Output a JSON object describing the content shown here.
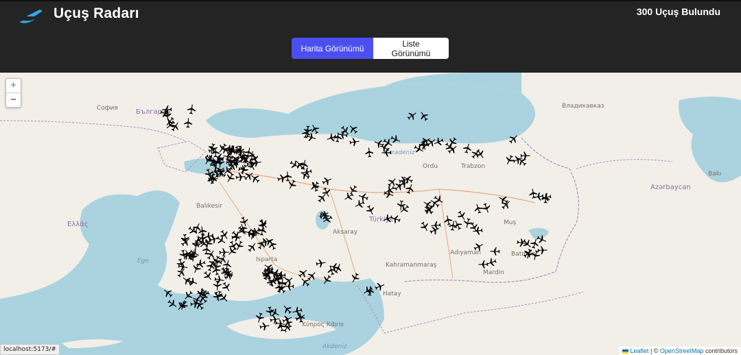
{
  "header": {
    "title": "Uçuş Radarı",
    "flight_count_text": "300 Uçuş Bulundu",
    "logo_icon": "plane-swoosh-icon"
  },
  "view_toggle": {
    "map_label": "Harita Görünümü",
    "list_label": "Liste Görünümü",
    "active": "map",
    "active_color": "#4b4ff0"
  },
  "map": {
    "zoom_in": "+",
    "zoom_out": "−",
    "plane_icon": "airplane-icon",
    "plane_color": "#000000",
    "sea_color": "#aad3df",
    "land_color": "#f2efe9",
    "labels": {
      "turkiye": "Türkiye",
      "karadeniz": "Karadeniz",
      "akdeniz": "Akdeniz",
      "ege": "Ege",
      "kibris": "Κύπρος Kıbrıs",
      "azerbaycan": "Azərbaycan",
      "ellada": "Ελλάς",
      "bulgaria": "България",
      "sofia": "София",
      "vladikavkaz": "Владикавказ",
      "baku": "Bakı",
      "balikesir": "Balıkesir",
      "isparta": "Isparta",
      "aksaray": "Aksaray",
      "adiyaman": "Adıyaman",
      "batman": "Batman",
      "mus": "Muş",
      "ordu": "Ordu",
      "trabzon": "Trabzon",
      "kahramanmaras": "Kahramanmaraş",
      "hatay": "Hatay",
      "mardin": "Mardin"
    },
    "attribution": {
      "leaflet": "Leaflet",
      "separator": " | © ",
      "osm": "OpenStreetMap",
      "suffix": " contributors"
    }
  },
  "status_bar": {
    "url": "localhost:5173/#"
  }
}
